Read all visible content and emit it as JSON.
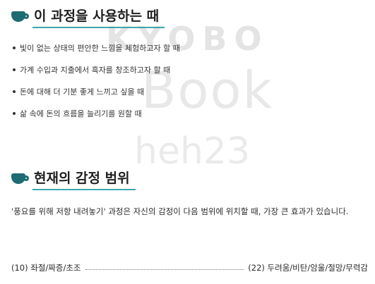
{
  "watermark": {
    "brand": "KYOBO",
    "book": "Book",
    "user": "heh23"
  },
  "section1": {
    "title": "이 과정을 사용하는 때",
    "icon": "teacup-icon",
    "items": [
      "빛이 없는 상태의 편안한 느낌을 체험하고자 할 때",
      "가계 수입과 지출에서 흑자를 창조하고자 할 때",
      "돈에 대해 더 기분 좋게 느끼고 싶을  때",
      "삶 속에 돈의 흐름을 늘리기를 원할 때"
    ]
  },
  "section2": {
    "title": "현재의 감정 범위",
    "icon": "teacup-icon",
    "paragraph": "'풍요를 위해 저항 내려놓기' 과정은 자신의 감정이 다음 범위에 위치할 때, 가장 큰 효과가 있습니다.",
    "range_start": "(10) 좌절/짜증/초조",
    "range_end": "(22) 두려움/비탄/암울/절망/무력감"
  },
  "colors": {
    "accent": "#3ea6ad",
    "icon": "#1d6b73"
  }
}
